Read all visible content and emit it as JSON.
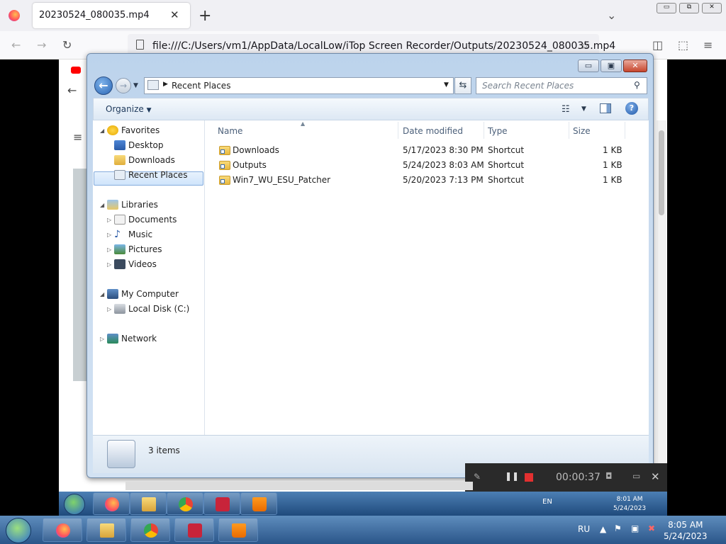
{
  "browser": {
    "tab_title": "20230524_080035.mp4",
    "tab_close": "✕",
    "new_tab": "+",
    "url": "file:///C:/Users/vm1/AppData/LocalLow/iTop Screen Recorder/Outputs/20230524_080035.mp4",
    "window_controls": [
      "▭",
      "⧉",
      "✕"
    ]
  },
  "explorer": {
    "caption_buttons": [
      "▭",
      "▣",
      "✕"
    ],
    "location": "Recent Places",
    "search_placeholder": "Search Recent Places",
    "organize_label": "Organize",
    "columns": [
      "Name",
      "Date modified",
      "Type",
      "Size"
    ],
    "nav_tree": {
      "favorites": {
        "label": "Favorites",
        "items": [
          "Desktop",
          "Downloads",
          "Recent Places"
        ]
      },
      "libraries": {
        "label": "Libraries",
        "items": [
          "Documents",
          "Music",
          "Pictures",
          "Videos"
        ]
      },
      "computer": {
        "label": "My Computer",
        "items": [
          "Local Disk (C:)"
        ]
      },
      "network": {
        "label": "Network"
      }
    },
    "files": [
      {
        "name": "Downloads",
        "date": "5/17/2023 8:30 PM",
        "type": "Shortcut",
        "size": "1 KB"
      },
      {
        "name": "Outputs",
        "date": "5/24/2023 8:03 AM",
        "type": "Shortcut",
        "size": "1 KB"
      },
      {
        "name": "Win7_WU_ESU_Patcher",
        "date": "5/20/2023 7:13 PM",
        "type": "Shortcut",
        "size": "1 KB"
      }
    ],
    "status_text": "3 items"
  },
  "recorder": {
    "time": "00:00:37"
  },
  "inner_taskbar": {
    "lang": "EN",
    "time": "8:01 AM",
    "date": "5/24/2023"
  },
  "taskbar": {
    "lang": "RU",
    "time": "8:05 AM",
    "date": "5/24/2023"
  },
  "icons": [
    "firefox-icon",
    "explorer-icon",
    "chrome-icon",
    "recorder-icon",
    "vlc-icon"
  ]
}
